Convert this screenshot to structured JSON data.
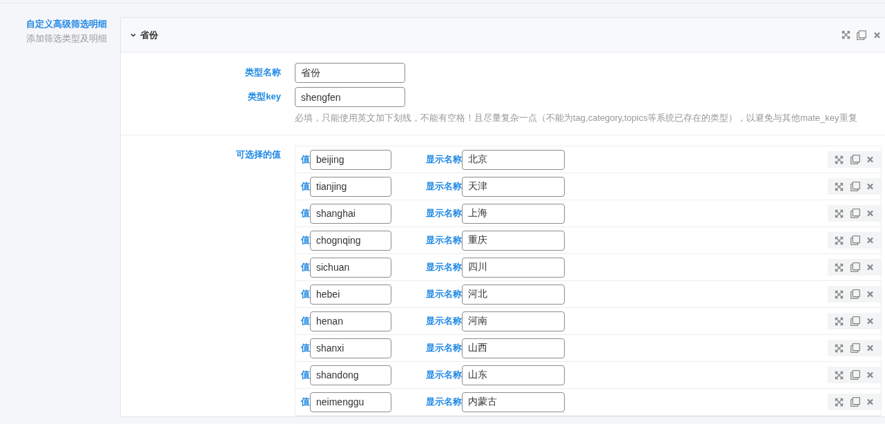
{
  "sidebar": {
    "title": "自定义高级筛选明细",
    "subtitle": "添加筛选类型及明细"
  },
  "panel": {
    "title": "省份",
    "expanded": true,
    "name_field": {
      "label": "类型名称",
      "value": "省份"
    },
    "key_field": {
      "label": "类型key",
      "value": "shengfen",
      "hint": "必填，只能使用英文加下划线，不能有空格！且尽量复杂一点（不能为tag,category,topics等系统已存在的类型），以避免与其他mate_key重复"
    },
    "options": {
      "label": "可选择的值",
      "rows": [
        {
          "value_label": "值",
          "value": "beijing",
          "name_label": "显示名称",
          "name": "北京"
        },
        {
          "value_label": "值",
          "value": "tianjing",
          "name_label": "显示名称",
          "name": "天津"
        },
        {
          "value_label": "值",
          "value": "shanghai",
          "name_label": "显示名称",
          "name": "上海"
        },
        {
          "value_label": "值",
          "value": "chognqing",
          "name_label": "显示名称",
          "name": "重庆"
        },
        {
          "value_label": "值",
          "value": "sichuan",
          "name_label": "显示名称",
          "name": "四川"
        },
        {
          "value_label": "值",
          "value": "hebei",
          "name_label": "显示名称",
          "name": "河北"
        },
        {
          "value_label": "值",
          "value": "henan",
          "name_label": "显示名称",
          "name": "河南"
        },
        {
          "value_label": "值",
          "value": "shanxi",
          "name_label": "显示名称",
          "name": "山西"
        },
        {
          "value_label": "值",
          "value": "shandong",
          "name_label": "显示名称",
          "name": "山东"
        },
        {
          "value_label": "值",
          "value": "neimenggu",
          "name_label": "显示名称",
          "name": "内蒙古"
        }
      ]
    }
  }
}
